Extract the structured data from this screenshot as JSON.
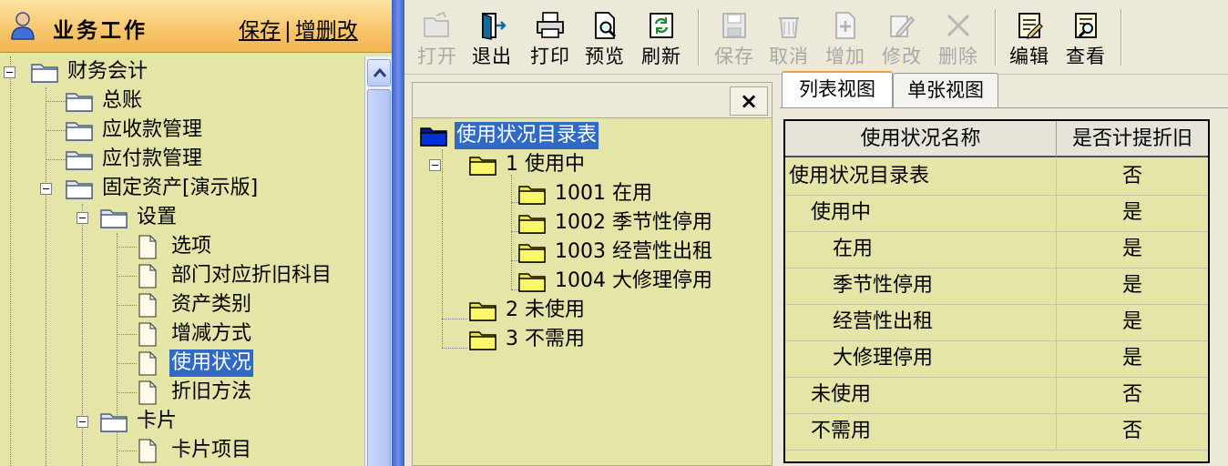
{
  "nav": {
    "title": "业务工作",
    "link_save": "保存",
    "link_sep": "|",
    "link_edit": "增删改",
    "tree": [
      {
        "label": "财务会计"
      },
      {
        "label": "总账"
      },
      {
        "label": "应收款管理"
      },
      {
        "label": "应付款管理"
      },
      {
        "label": "固定资产[演示版]"
      },
      {
        "label": "设置"
      },
      {
        "label": "选项"
      },
      {
        "label": "部门对应折旧科目"
      },
      {
        "label": "资产类别"
      },
      {
        "label": "增减方式"
      },
      {
        "label": "使用状况"
      },
      {
        "label": "折旧方法"
      },
      {
        "label": "卡片"
      },
      {
        "label": "卡片项目"
      }
    ]
  },
  "toolbar": {
    "open": "打开",
    "exit": "退出",
    "print": "打印",
    "preview": "预览",
    "refresh": "刷新",
    "save": "保存",
    "cancel": "取消",
    "add": "增加",
    "modify": "修改",
    "delete": "删除",
    "edit": "编辑",
    "view": "查看"
  },
  "middle": {
    "close": "×",
    "tree": [
      {
        "label": "使用状况目录表"
      },
      {
        "label": "1 使用中"
      },
      {
        "label": "1001 在用"
      },
      {
        "label": "1002 季节性停用"
      },
      {
        "label": "1003 经营性出租"
      },
      {
        "label": "1004 大修理停用"
      },
      {
        "label": "2 未使用"
      },
      {
        "label": "3 不需用"
      }
    ]
  },
  "tabs": {
    "list_view": "列表视图",
    "single_view": "单张视图"
  },
  "grid": {
    "headers": [
      "使用状况名称",
      "是否计提折旧"
    ],
    "rows": [
      {
        "name": "使用状况目录表",
        "flag": "否"
      },
      {
        "name": "使用中",
        "flag": "是"
      },
      {
        "name": "在用",
        "flag": "是"
      },
      {
        "name": "季节性停用",
        "flag": "是"
      },
      {
        "name": "经营性出租",
        "flag": "是"
      },
      {
        "name": "大修理停用",
        "flag": "是"
      },
      {
        "name": "未使用",
        "flag": "否"
      },
      {
        "name": "不需用",
        "flag": "否"
      }
    ]
  },
  "colors": {
    "panel_bg": "#e4e5a6",
    "header_orange": "#f7c46a",
    "selection": "#316ac5",
    "splitter_blue": "#3b62c9"
  }
}
